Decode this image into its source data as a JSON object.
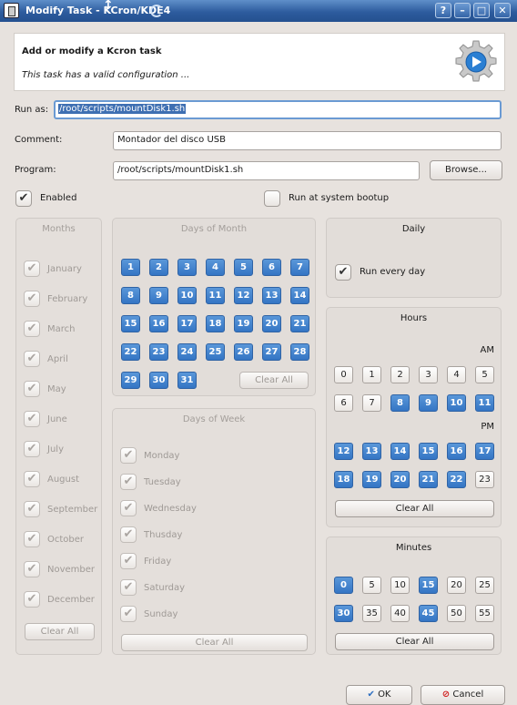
{
  "window": {
    "title": "Modify Task - KCron/KDE4",
    "buttons": {
      "help": "?",
      "minimize": "–",
      "maximize": "□",
      "close": "✕"
    }
  },
  "header": {
    "title": "Add or modify a Kcron task",
    "subtitle": "This task has a valid configuration ..."
  },
  "form": {
    "run_as_label": "Run as:",
    "run_as_value": "/root/scripts/mountDisk1.sh",
    "comment_label": "Comment:",
    "comment_value": "Montador del disco USB",
    "program_label": "Program:",
    "program_value": "/root/scripts/mountDisk1.sh",
    "browse_label": "Browse...",
    "enabled_label": "Enabled",
    "enabled_checked": true,
    "run_at_boot_label": "Run at system bootup",
    "run_at_boot_checked": false
  },
  "months": {
    "title": "Months",
    "items": [
      "January",
      "February",
      "March",
      "April",
      "May",
      "June",
      "July",
      "August",
      "September",
      "October",
      "November",
      "December"
    ],
    "clear_label": "Clear All"
  },
  "days_of_month": {
    "title": "Days of Month",
    "days": [
      "1",
      "2",
      "3",
      "4",
      "5",
      "6",
      "7",
      "8",
      "9",
      "10",
      "11",
      "12",
      "13",
      "14",
      "15",
      "16",
      "17",
      "18",
      "19",
      "20",
      "21",
      "22",
      "23",
      "24",
      "25",
      "26",
      "27",
      "28",
      "29",
      "30",
      "31"
    ],
    "clear_label": "Clear All"
  },
  "days_of_week": {
    "title": "Days of Week",
    "items": [
      "Monday",
      "Tuesday",
      "Wednesday",
      "Thusday",
      "Friday",
      "Saturday",
      "Sunday"
    ],
    "clear_label": "Clear All"
  },
  "daily": {
    "title": "Daily",
    "run_every_day_label": "Run every day",
    "checked": true
  },
  "hours": {
    "title": "Hours",
    "am_label": "AM",
    "pm_label": "PM",
    "am": [
      {
        "v": "0",
        "on": false
      },
      {
        "v": "1",
        "on": false
      },
      {
        "v": "2",
        "on": false
      },
      {
        "v": "3",
        "on": false
      },
      {
        "v": "4",
        "on": false
      },
      {
        "v": "5",
        "on": false
      },
      {
        "v": "6",
        "on": false
      },
      {
        "v": "7",
        "on": false
      },
      {
        "v": "8",
        "on": true
      },
      {
        "v": "9",
        "on": true
      },
      {
        "v": "10",
        "on": true
      },
      {
        "v": "11",
        "on": true
      }
    ],
    "pm": [
      {
        "v": "12",
        "on": true
      },
      {
        "v": "13",
        "on": true
      },
      {
        "v": "14",
        "on": true
      },
      {
        "v": "15",
        "on": true
      },
      {
        "v": "16",
        "on": true
      },
      {
        "v": "17",
        "on": true
      },
      {
        "v": "18",
        "on": true
      },
      {
        "v": "19",
        "on": true
      },
      {
        "v": "20",
        "on": true
      },
      {
        "v": "21",
        "on": true
      },
      {
        "v": "22",
        "on": true
      },
      {
        "v": "23",
        "on": false
      }
    ],
    "clear_label": "Clear All"
  },
  "minutes": {
    "title": "Minutes",
    "items": [
      {
        "v": "0",
        "on": true
      },
      {
        "v": "5",
        "on": false
      },
      {
        "v": "10",
        "on": false
      },
      {
        "v": "15",
        "on": true
      },
      {
        "v": "20",
        "on": false
      },
      {
        "v": "25",
        "on": false
      },
      {
        "v": "30",
        "on": true
      },
      {
        "v": "35",
        "on": false
      },
      {
        "v": "40",
        "on": false
      },
      {
        "v": "45",
        "on": true
      },
      {
        "v": "50",
        "on": false
      },
      {
        "v": "55",
        "on": false
      }
    ],
    "clear_label": "Clear All"
  },
  "footer": {
    "ok_label": "OK",
    "cancel_label": "Cancel"
  },
  "colors": {
    "titlebar": "#2d5c9e",
    "selected_cell": "#3475c4",
    "focus_border": "#6a9ad3"
  }
}
